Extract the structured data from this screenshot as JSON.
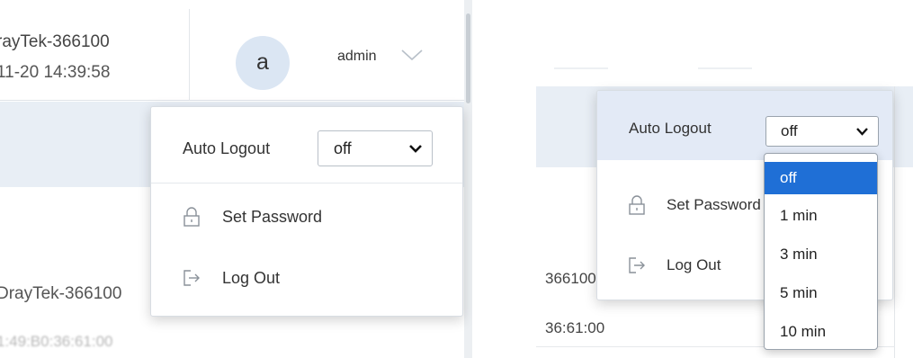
{
  "left": {
    "device_name": "rayTek-366100",
    "device_time": "11-20 14:39:58",
    "avatar_letter": "a",
    "username": "admin",
    "device_name_row2": "DrayTek-366100",
    "mac_row": "1:49:B0:36:61:00",
    "menu": {
      "auto_logout_label": "Auto Logout",
      "auto_logout_value": "off",
      "set_password_label": "Set Password",
      "log_out_label": "Log Out"
    }
  },
  "right": {
    "device_name_row": "366100",
    "mac_row": "36:61:00",
    "menu": {
      "auto_logout_label": "Auto Logout",
      "auto_logout_value": "off",
      "set_password_label": "Set Password",
      "log_out_label": "Log Out"
    },
    "dropdown_options": [
      {
        "label": "off",
        "selected": true
      },
      {
        "label": "1 min",
        "selected": false
      },
      {
        "label": "3 min",
        "selected": false
      },
      {
        "label": "5 min",
        "selected": false
      },
      {
        "label": "10 min",
        "selected": false
      }
    ]
  },
  "colors": {
    "accent_selected": "#1f6fd6",
    "hover_row": "#e3eaf6",
    "avatar_bg": "#dbe6f3",
    "strip_bg": "#e8eef5"
  },
  "icons": {
    "lock": "lock-icon",
    "logout": "logout-icon",
    "chevron": "chevron-down-icon",
    "caret": "select-caret-icon"
  }
}
